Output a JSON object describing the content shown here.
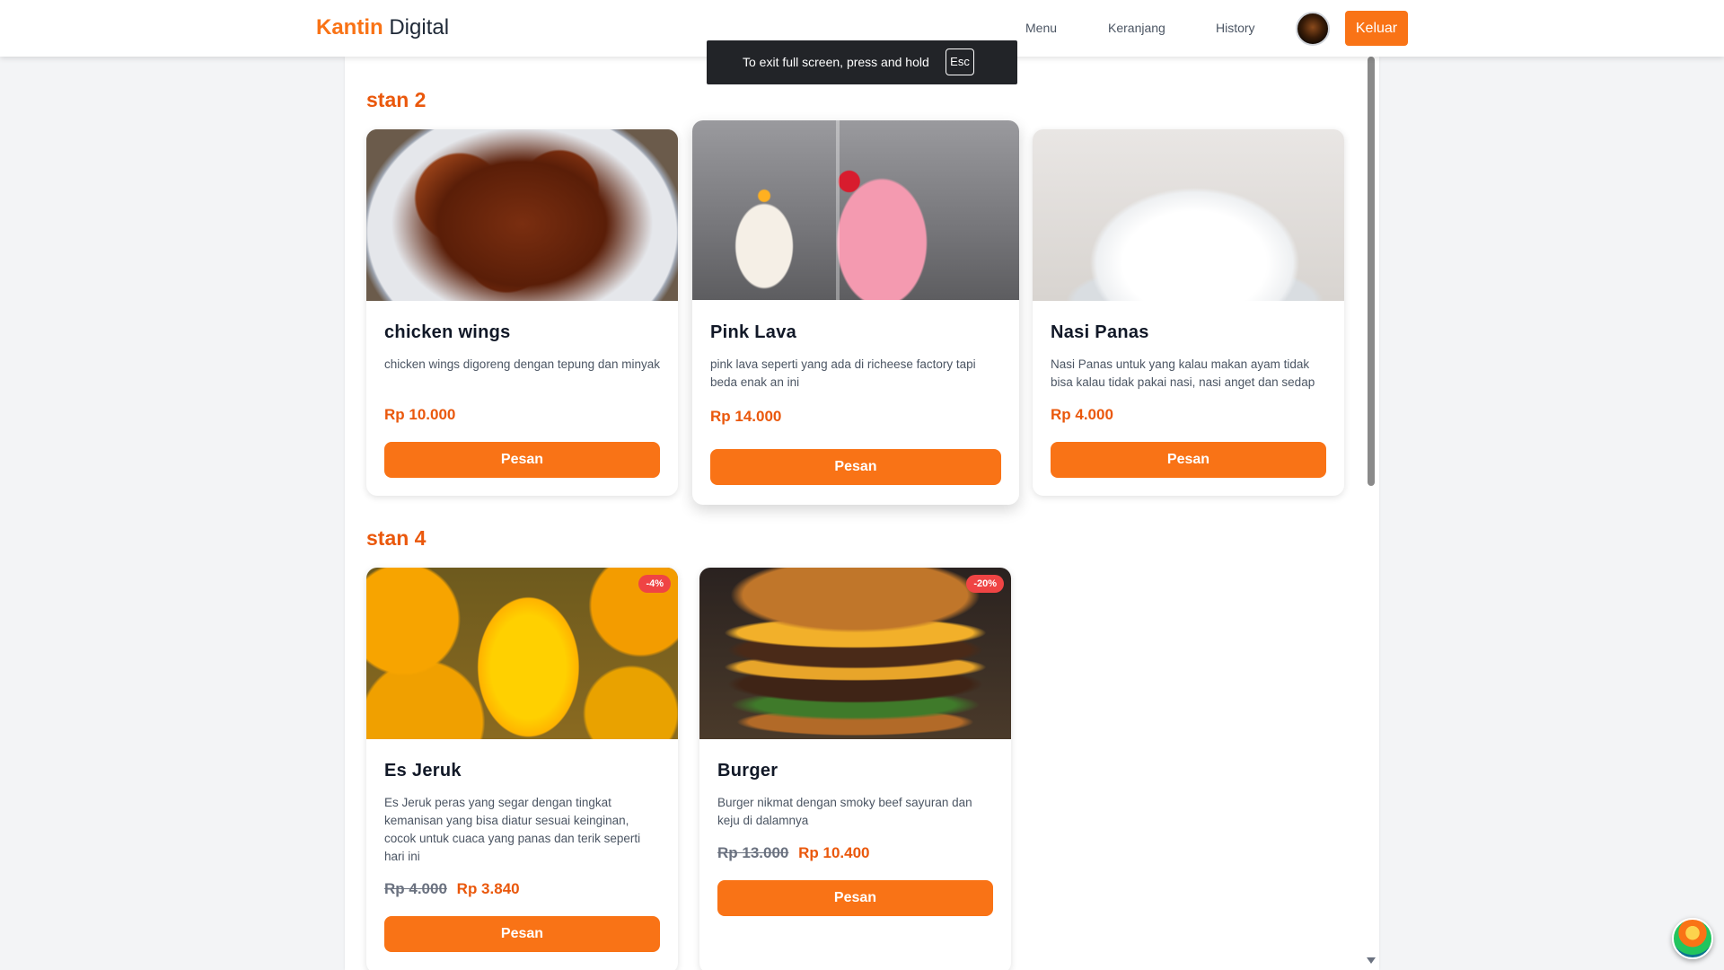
{
  "navbar": {
    "brand_primary": "Kantin",
    "brand_secondary": "Digital",
    "links": [
      "Menu",
      "Keranjang",
      "History"
    ],
    "logout_label": "Keluar"
  },
  "fullscreen_notice": {
    "text": "To exit full screen, press and hold",
    "key": "Esc"
  },
  "stalls": [
    {
      "title": "stan 2",
      "items": [
        {
          "name": "chicken wings",
          "description": "chicken wings digoreng dengan tepung dan minyak",
          "price": "Rp 10.000",
          "order_label": "Pesan",
          "image": "chicken-wings-photo"
        },
        {
          "name": "Pink Lava",
          "description": "pink lava seperti yang ada di richeese factory tapi beda enak an ini",
          "price": "Rp 14.000",
          "order_label": "Pesan",
          "image": "pink-lava-drink-photo"
        },
        {
          "name": "Nasi Panas",
          "description": "Nasi Panas untuk yang kalau makan ayam tidak bisa kalau tidak pakai nasi, nasi anget dan sedap",
          "price": "Rp 4.000",
          "order_label": "Pesan",
          "image": "rice-bowl-photo"
        }
      ]
    },
    {
      "title": "stan 4",
      "items": [
        {
          "name": "Es Jeruk",
          "description": "Es Jeruk peras yang segar dengan tingkat kemanisan yang bisa diatur sesuai keinginan, cocok untuk cuaca yang panas dan terik seperti hari ini",
          "price_original": "Rp 4.000",
          "price": "Rp 3.840",
          "discount": "-4%",
          "order_label": "Pesan",
          "image": "orange-juice-photo"
        },
        {
          "name": "Burger",
          "description": "Burger nikmat dengan smoky beef sayuran dan keju di dalamnya",
          "price_original": "Rp 13.000",
          "price": "Rp 10.400",
          "discount": "-20%",
          "order_label": "Pesan",
          "image": "burger-photo"
        }
      ]
    }
  ],
  "colors": {
    "accent": "#f97316",
    "price": "#ea580c",
    "discount_badge": "#ef4444"
  }
}
